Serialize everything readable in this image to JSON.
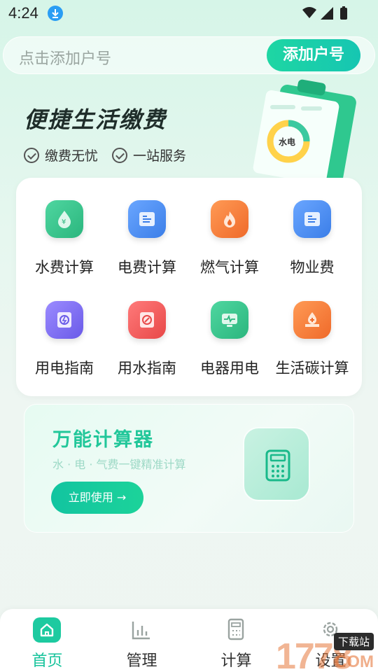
{
  "status_bar": {
    "time": "4:24"
  },
  "search": {
    "placeholder": "点击添加户号",
    "add_button": "添加户号"
  },
  "banner": {
    "title": "便捷生活缴费",
    "features": [
      "缴费无忧",
      "一站服务"
    ],
    "illustration_label": "水电"
  },
  "services": [
    {
      "label": "水费计算",
      "icon": "water-drop-yen-icon",
      "color": "#3cc58f"
    },
    {
      "label": "电费计算",
      "icon": "bill-document-icon",
      "color": "#4a8ef0"
    },
    {
      "label": "燃气计算",
      "icon": "flame-icon",
      "color": "#f07a3a"
    },
    {
      "label": "物业费",
      "icon": "property-document-icon",
      "color": "#4a8ef0"
    },
    {
      "label": "用电指南",
      "icon": "electric-guide-icon",
      "color": "#7b6ef0"
    },
    {
      "label": "用水指南",
      "icon": "water-guide-icon",
      "color": "#ef5a5a"
    },
    {
      "label": "电器用电",
      "icon": "monitor-pulse-icon",
      "color": "#32c28a"
    },
    {
      "label": "生活碳计算",
      "icon": "carbon-hand-icon",
      "color": "#f07a3a"
    }
  ],
  "calculator": {
    "title": "万能计算器",
    "subtitle": "水 · 电 · 气费一键精准计算",
    "button": "立即使用 →",
    "icon": "calculator-icon"
  },
  "bottom_nav": [
    {
      "label": "首页",
      "icon": "home-icon",
      "active": true
    },
    {
      "label": "管理",
      "icon": "bar-chart-icon",
      "active": false
    },
    {
      "label": "计算",
      "icon": "calculator-icon",
      "active": false
    },
    {
      "label": "设置",
      "icon": "gear-icon",
      "active": false
    }
  ],
  "watermark": {
    "text": "1778",
    "tag": "下载站",
    "suffix": "COM"
  }
}
